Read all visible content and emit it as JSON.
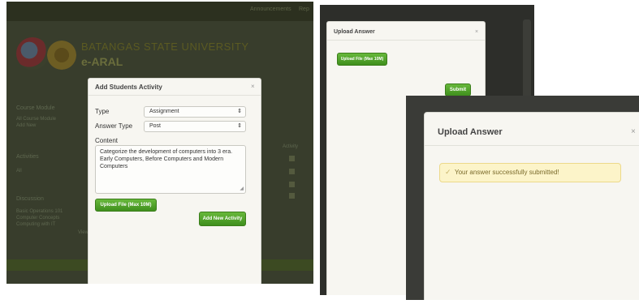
{
  "panel1": {
    "topbar_items": [
      "Announcements",
      "Rep"
    ],
    "brand": {
      "line1": "BATANGAS STATE UNIVERSITY",
      "line2": "e-ARAL"
    },
    "sidebar": {
      "course_module_header": "Course Module",
      "course_module_items": [
        "All Course Module",
        "Add New"
      ],
      "activities_header": "Activities",
      "activities_items": [
        "All"
      ],
      "discussion_header": "Discussion",
      "discussion_items": [
        "Basic Operations 101",
        "Computer Concepts",
        "Computing with IT"
      ],
      "view_all": "View All"
    },
    "table_label": "Activity",
    "modal": {
      "title": "Add Students Activity",
      "close": "×",
      "type_label": "Type",
      "type_value": "Assignment",
      "answer_type_label": "Answer Type",
      "answer_type_value": "Post",
      "content_label": "Content",
      "content_value": "Categorize the development of computers into 3 era. Early Computers, Before Computers and Modern Computers",
      "upload_button": "Upload File (Max 10M)",
      "add_button": "Add New Activity"
    }
  },
  "panel2": {
    "modal": {
      "title": "Upload Answer",
      "close": "×",
      "upload_button": "Upload File (Max 10M)",
      "submit_button": "Submit"
    }
  },
  "panel3": {
    "modal": {
      "title": "Upload Answer",
      "close": "×",
      "message_icon": "check-icon",
      "message": "Your answer successfully submitted!"
    }
  },
  "colors": {
    "overlay_panel1": "#383d2c",
    "overlay_panel2": "#2d2e2a",
    "modal_bg": "#f7f6f1",
    "button_green": "#4c9e27",
    "success_bg": "#fcf4c9",
    "success_border": "#ecd98a"
  }
}
